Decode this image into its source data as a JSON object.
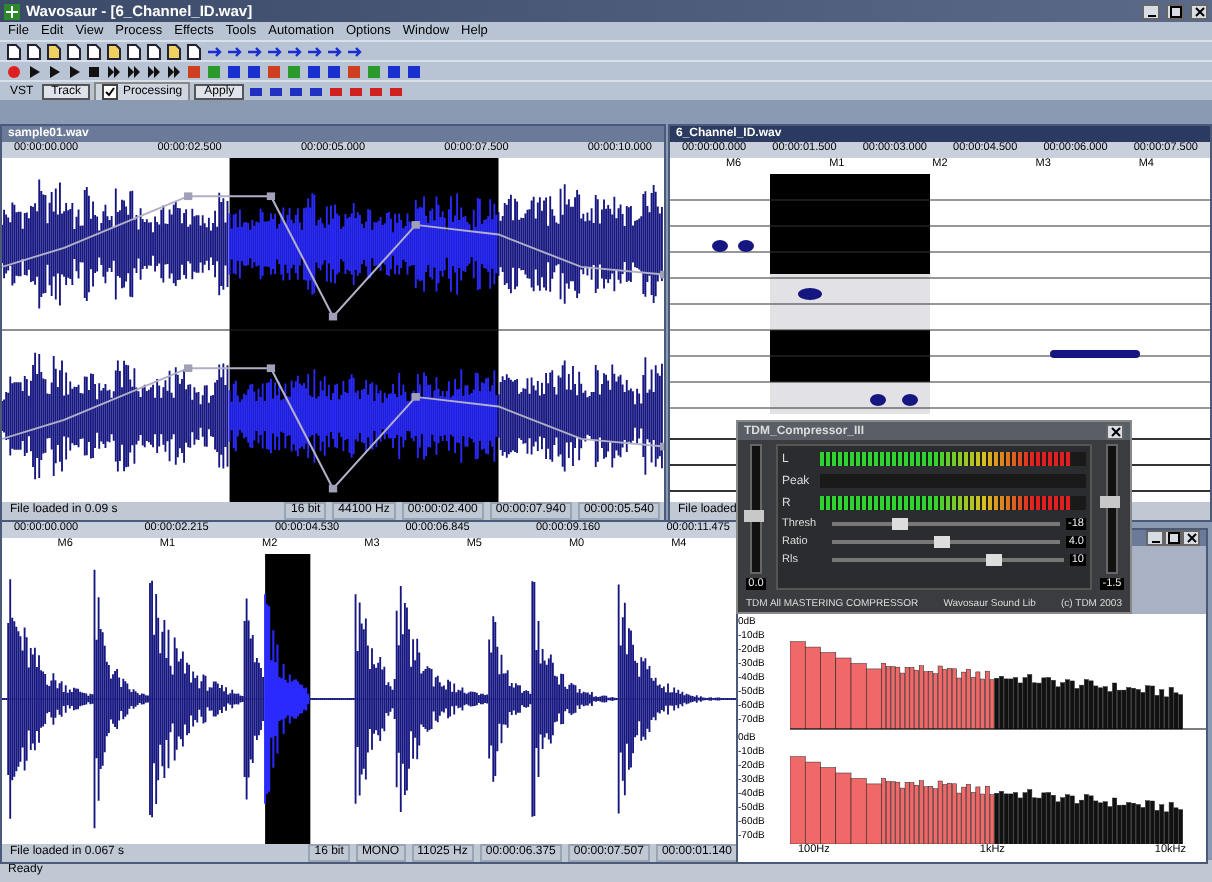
{
  "window": {
    "title": "Wavosaur - [6_Channel_ID.wav]"
  },
  "menu": [
    "File",
    "Edit",
    "View",
    "Process",
    "Effects",
    "Tools",
    "Automation",
    "Options",
    "Window",
    "Help"
  ],
  "toolbar": {
    "vst": "VST",
    "track": "Track",
    "processing": {
      "label": "Processing",
      "checked": true
    },
    "apply": "Apply"
  },
  "stereo_doc": {
    "title": "sample01.wav",
    "ruler": [
      "00:00:00.000",
      "00:00:02.500",
      "00:00:05.000",
      "00:00:07.500",
      "00:00:10.000"
    ],
    "status": [
      "File loaded in 0.09 s",
      "16 bit",
      "44100 Hz",
      "00:00:02.400",
      "00:00:07.940",
      "00:00:05.540"
    ]
  },
  "multi_doc": {
    "title": "6_Channel_ID.wav",
    "ruler": [
      "00:00:00.000",
      "00:00:01.500",
      "00:00:03.000",
      "00:00:04.500",
      "00:00:06.000",
      "00:00:07.500"
    ],
    "markers": [
      "M6",
      "M1",
      "M2",
      "M3",
      "M4"
    ],
    "status": [
      "File loaded"
    ]
  },
  "mono_doc": {
    "ruler": [
      "00:00:00.000",
      "00:00:02.215",
      "00:00:04.530",
      "00:00:06.845",
      "00:00:09.160",
      "00:00:11.475"
    ],
    "markers": [
      "M6",
      "M1",
      "M2",
      "M3",
      "M5",
      "M0",
      "M4"
    ],
    "status": [
      "File loaded in 0.067 s",
      "16 bit",
      "MONO",
      "11025 Hz",
      "00:00:06.375",
      "00:00:07.507",
      "00:00:01.140"
    ]
  },
  "compressor": {
    "title": "TDM_Compressor_III",
    "meters": [
      {
        "label": "L",
        "level": 0.95
      },
      {
        "label": "Peak"
      },
      {
        "label": "R",
        "level": 0.95
      }
    ],
    "params": [
      {
        "label": "Thresh",
        "level": 0.3,
        "reading": "-18"
      },
      {
        "label": "Ratio",
        "level": 0.48,
        "reading": "4.0"
      },
      {
        "label": "Rls",
        "level": 0.7,
        "reading": "10"
      }
    ],
    "input": {
      "level": 0.45,
      "reading": "0.0"
    },
    "output": {
      "level": 0.55,
      "reading": "-1.5"
    },
    "footer": [
      "TDM All MASTERING COMPRESSOR",
      "Wavosaur Sound Lib",
      "(c) TDM 2003"
    ]
  },
  "spectrum": {
    "channels": [
      {
        "y_labels": [
          "0dB",
          "-10dB",
          "-20dB",
          "-30dB",
          "-40dB",
          "-50dB",
          "-60dB",
          "-70dB"
        ]
      },
      {
        "y_labels": [
          "0dB",
          "-10dB",
          "-20dB",
          "-30dB",
          "-40dB",
          "-50dB",
          "-60dB",
          "-70dB"
        ]
      }
    ],
    "x_labels": [
      "100Hz",
      "1kHz",
      "10kHz"
    ]
  },
  "status_bar": "Ready"
}
